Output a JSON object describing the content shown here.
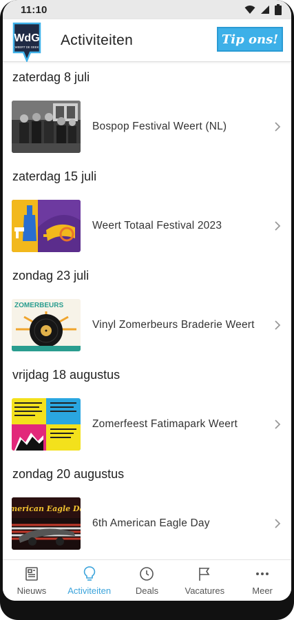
{
  "status": {
    "time": "11:10"
  },
  "header": {
    "title": "Activiteiten",
    "tip_label": "Tip ons!",
    "logo_text": "WdG",
    "logo_sub": "WEERT DE GEEK"
  },
  "events": [
    {
      "date": "zaterdag 8 juli",
      "title": "Bospop Festival Weert (NL)"
    },
    {
      "date": "zaterdag 15 juli",
      "title": "Weert Totaal Festival 2023"
    },
    {
      "date": "zondag 23 juli",
      "title": "Vinyl Zomerbeurs Braderie Weert",
      "thumb_text": "ZOMERBEURS"
    },
    {
      "date": "vrijdag 18 augustus",
      "title": "Zomerfeest Fatimapark Weert"
    },
    {
      "date": "zondag 20 augustus",
      "title": "6th American Eagle Day",
      "thumb_text": "American Eagle Day"
    }
  ],
  "nav": [
    {
      "label": "Nieuws",
      "icon": "newspaper-icon"
    },
    {
      "label": "Activiteiten",
      "icon": "lightbulb-icon",
      "active": true
    },
    {
      "label": "Deals",
      "icon": "clock-icon"
    },
    {
      "label": "Vacatures",
      "icon": "flag-icon"
    },
    {
      "label": "Meer",
      "icon": "more-icon"
    }
  ],
  "colors": {
    "accent": "#3aa3db",
    "tip_button": "#3db0e8",
    "logo": "#1f2a44"
  }
}
